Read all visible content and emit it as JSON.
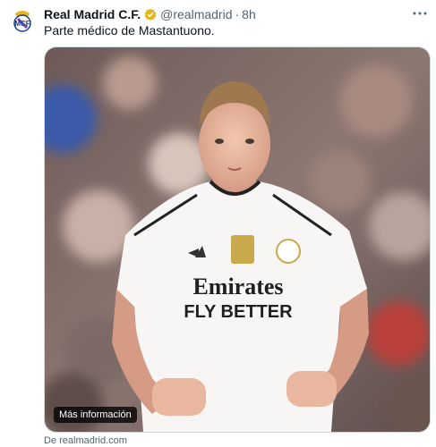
{
  "tweet": {
    "author_name": "Real Madrid C.F.",
    "handle": "@realmadrid",
    "separator": "·",
    "time": "8h",
    "text": "Parte médico de Mastantuono.",
    "more_glyph": "···"
  },
  "card": {
    "more_info_label": "Más información",
    "source": "De realmadrid.com",
    "shirt_sponsor_line1": "Emirates",
    "shirt_sponsor_line2": "FLY BETTER"
  },
  "colors": {
    "verified_badge": "#e2b719",
    "text_primary": "#0f1419",
    "text_secondary": "#536471"
  },
  "icons": {
    "avatar": "real-madrid-crest-icon",
    "badge": "verified-gold-icon",
    "more": "more-options-icon"
  }
}
